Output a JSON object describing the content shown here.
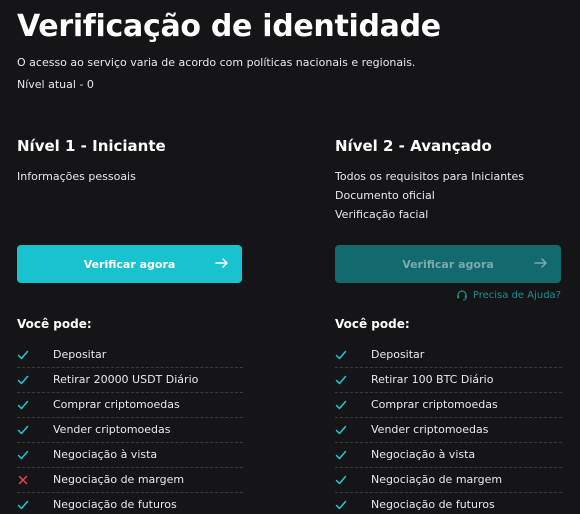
{
  "header": {
    "title": "Verificação de identidade",
    "subtitle": "O acesso ao serviço varia de acordo com políticas nacionais e regionais.",
    "current_level": "Nível atual - 0"
  },
  "colors": {
    "background": "#151517",
    "accent": "#18c3cf",
    "accent_disabled": "#126a6e",
    "check": "#1ec8d3",
    "cross": "#e4464d",
    "help_link": "#1a8f97"
  },
  "levels": [
    {
      "title": "Nível 1 - Iniciante",
      "requirements": [
        "Informações pessoais"
      ],
      "button_label": "Verificar agora",
      "button_icon": "arrow-right-icon",
      "button_enabled": true,
      "can_title": "Você pode:",
      "permissions": [
        {
          "label": "Depositar",
          "allowed": true,
          "icon": "check-icon"
        },
        {
          "label": "Retirar 20000 USDT Diário",
          "allowed": true,
          "icon": "check-icon"
        },
        {
          "label": "Comprar criptomoedas",
          "allowed": true,
          "icon": "check-icon"
        },
        {
          "label": "Vender criptomoedas",
          "allowed": true,
          "icon": "check-icon"
        },
        {
          "label": "Negociação à vista",
          "allowed": true,
          "icon": "check-icon"
        },
        {
          "label": "Negociação de margem",
          "allowed": false,
          "icon": "cross-icon"
        },
        {
          "label": "Negociação de futuros",
          "allowed": true,
          "icon": "check-icon"
        }
      ]
    },
    {
      "title": "Nível 2 - Avançado",
      "requirements": [
        "Todos os requisitos para Iniciantes",
        "Documento oficial",
        "Verificação facial"
      ],
      "button_label": "Verificar agora",
      "button_icon": "arrow-right-icon",
      "button_enabled": false,
      "help_label": "Precisa de Ajuda?",
      "help_icon": "headset-icon",
      "can_title": "Você pode:",
      "permissions": [
        {
          "label": "Depositar",
          "allowed": true,
          "icon": "check-icon"
        },
        {
          "label": "Retirar 100 BTC Diário",
          "allowed": true,
          "icon": "check-icon"
        },
        {
          "label": "Comprar criptomoedas",
          "allowed": true,
          "icon": "check-icon"
        },
        {
          "label": "Vender criptomoedas",
          "allowed": true,
          "icon": "check-icon"
        },
        {
          "label": "Negociação à vista",
          "allowed": true,
          "icon": "check-icon"
        },
        {
          "label": "Negociação de margem",
          "allowed": true,
          "icon": "check-icon"
        },
        {
          "label": "Negociação de futuros",
          "allowed": true,
          "icon": "check-icon"
        }
      ]
    }
  ]
}
